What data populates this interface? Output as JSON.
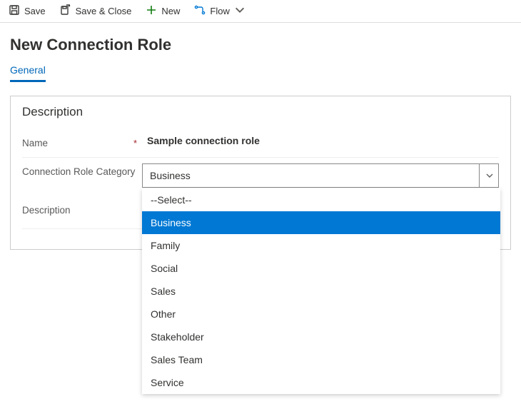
{
  "commands": {
    "save": "Save",
    "saveClose": "Save & Close",
    "new": "New",
    "flow": "Flow"
  },
  "page": {
    "title": "New Connection Role"
  },
  "tabs": {
    "general": "General"
  },
  "section": {
    "title": "Description",
    "name_label": "Name",
    "name_value": "Sample connection role",
    "category_label": "Connection Role Category",
    "category_value": "Business",
    "description_label": "Description",
    "description_value": "---"
  },
  "options": {
    "o0": "--Select--",
    "o1": "Business",
    "o2": "Family",
    "o3": "Social",
    "o4": "Sales",
    "o5": "Other",
    "o6": "Stakeholder",
    "o7": "Sales Team",
    "o8": "Service"
  }
}
